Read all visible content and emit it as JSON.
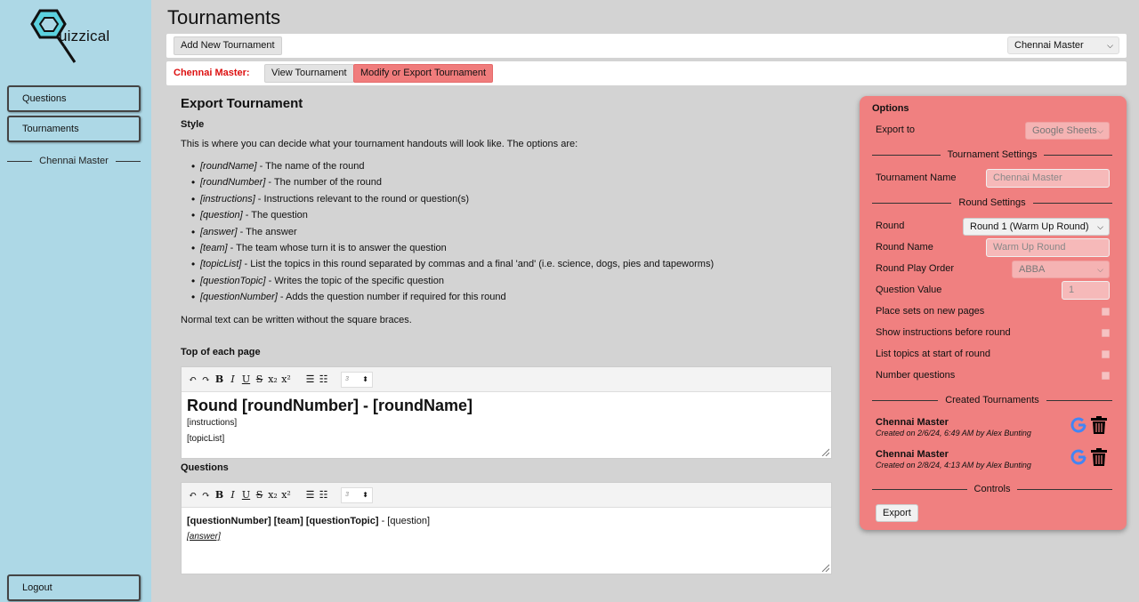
{
  "app": {
    "logo_text": "uizzical"
  },
  "sidebar": {
    "items": [
      {
        "label": "Questions"
      },
      {
        "label": "Tournaments"
      }
    ],
    "current_tournament": "Chennai Master",
    "logout_label": "Logout"
  },
  "page": {
    "title": "Tournaments"
  },
  "topbar": {
    "add_button": "Add New Tournament",
    "tournament_select": "Chennai Master"
  },
  "subbar": {
    "label": "Chennai Master:",
    "view_button": "View Tournament",
    "modify_button": "Modify or Export Tournament"
  },
  "export": {
    "heading": "Export Tournament",
    "style_heading": "Style",
    "intro": "This is where you can decide what your tournament handouts will look like. The options are:",
    "options": [
      {
        "token": "[roundName]",
        "desc": " - The name of the round"
      },
      {
        "token": "[roundNumber]",
        "desc": " - The number of the round"
      },
      {
        "token": "[instructions]",
        "desc": " - Instructions relevant to the round or question(s)"
      },
      {
        "token": "[question]",
        "desc": " - The question"
      },
      {
        "token": "[answer]",
        "desc": " - The answer"
      },
      {
        "token": "[team]",
        "desc": " - The team whose turn it is to answer the question"
      },
      {
        "token": "[topicList]",
        "desc": " - List the topics in this round separated by commas and a final 'and' (i.e. science, dogs, pies and tapeworms)"
      },
      {
        "token": "[questionTopic]",
        "desc": " - Writes the topic of the specific question"
      },
      {
        "token": "[questionNumber]",
        "desc": " - Adds the question number if required for this round"
      }
    ],
    "normal_text": "Normal text can be written without the square braces.",
    "top_heading": "Top of each page",
    "top_editor": {
      "line1": "Round [roundNumber] - [roundName]",
      "line2": "[instructions]",
      "line3": "[topicList]"
    },
    "questions_heading": "Questions",
    "q_editor": {
      "bold": "[questionNumber] [team] [questionTopic]",
      "dash": " - ",
      "plain": "[question]",
      "answer": "[answer]"
    },
    "toolbar": {
      "undo": "↶",
      "redo": "↷",
      "bold": "B",
      "italic": "I",
      "underline": "U",
      "strike": "S",
      "sub": "x₂",
      "sup": "x²",
      "bullets": "☰",
      "numbers": "☷",
      "size": "3"
    }
  },
  "panel": {
    "header": "Options",
    "export_to_label": "Export to",
    "export_to_value": "Google Sheets",
    "tournament_settings": "Tournament Settings",
    "tournament_name_label": "Tournament Name",
    "tournament_name_placeholder": "Chennai Master",
    "round_settings": "Round Settings",
    "round_label": "Round",
    "round_value": "Round 1 (Warm Up Round)",
    "round_name_label": "Round Name",
    "round_name_placeholder": "Warm Up Round",
    "play_order_label": "Round Play Order",
    "play_order_value": "ABBA",
    "question_value_label": "Question Value",
    "question_value_placeholder": "1",
    "checkbox_labels": [
      "Place sets on new pages",
      "Show instructions before round",
      "List topics at start of round",
      "Number questions"
    ],
    "created_heading": "Created Tournaments",
    "created": [
      {
        "name": "Chennai Master",
        "meta": "Created on 2/6/24, 6:49 AM by Alex Bunting"
      },
      {
        "name": "Chennai Master",
        "meta": "Created on 2/8/24, 4:13 AM by Alex Bunting"
      }
    ],
    "controls_heading": "Controls",
    "export_button": "Export"
  },
  "colors": {
    "sidebar": "#add8e6",
    "panel": "#f08080",
    "active": "#f07c7c",
    "accent_red": "#d11111",
    "google_blue": "#4285f4"
  }
}
